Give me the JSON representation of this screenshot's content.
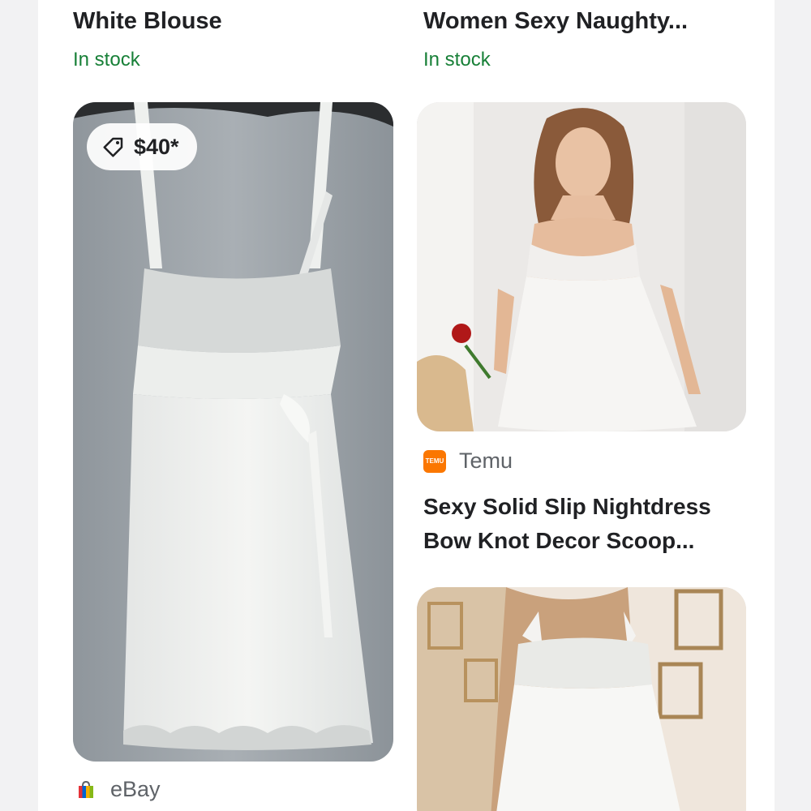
{
  "results": [
    {
      "title_lines": [
        "White Blouse"
      ],
      "stock": "In stock"
    },
    {
      "title_lines": [
        "Women Sexy Naughty..."
      ],
      "stock": "In stock"
    },
    {
      "price": "$40*",
      "source": "eBay",
      "image_icon": "white-lace-chemise-photo"
    },
    {
      "source": "Temu",
      "source_logo_text": "TEMU",
      "title_lines": [
        "Sexy Solid Slip Nightdress",
        "Bow Knot Decor Scoop..."
      ],
      "image_icon": "model-white-nightdress-photo"
    },
    {
      "image_icon": "mannequin-white-nightgown-photo"
    }
  ],
  "colors": {
    "stock_green": "#188038",
    "temu_orange": "#fb7701",
    "title_text": "#202124",
    "meta_text": "#5f6368"
  }
}
